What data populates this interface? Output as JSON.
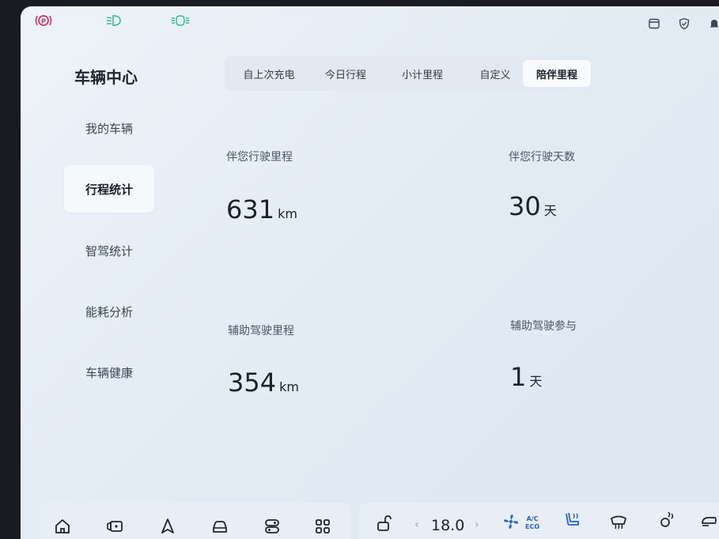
{
  "nav": {
    "title": "车辆中心",
    "items": [
      {
        "label": "我的车辆"
      },
      {
        "label": "行程统计"
      },
      {
        "label": "智驾统计"
      },
      {
        "label": "能耗分析"
      },
      {
        "label": "车辆健康"
      }
    ],
    "active_index": 1
  },
  "tabs": [
    {
      "label": "自上次充电"
    },
    {
      "label": "今日行程"
    },
    {
      "label": "小计里程"
    },
    {
      "label": "自定义"
    },
    {
      "label": "陪伴里程"
    }
  ],
  "active_tab": 4,
  "stats": {
    "companion_mileage": {
      "label": "伴您行驶里程",
      "value": "631",
      "unit": "km"
    },
    "companion_days": {
      "label": "伴您行驶天数",
      "value": "30",
      "unit": "天"
    },
    "assist_mileage": {
      "label": "辅助驾驶里程",
      "value": "354",
      "unit": "km"
    },
    "assist_days": {
      "label": "辅助驾驶参与",
      "value": "1",
      "unit": "天"
    }
  },
  "climate": {
    "temperature": "18.0",
    "ac_line1": "A/C",
    "ac_line2": "ECO",
    "left_arrow": "‹",
    "right_arrow": "›"
  },
  "colors": {
    "accent": "#2a5fd6",
    "parking_brake": "#d6336c",
    "lights": "#2fbf8f"
  }
}
